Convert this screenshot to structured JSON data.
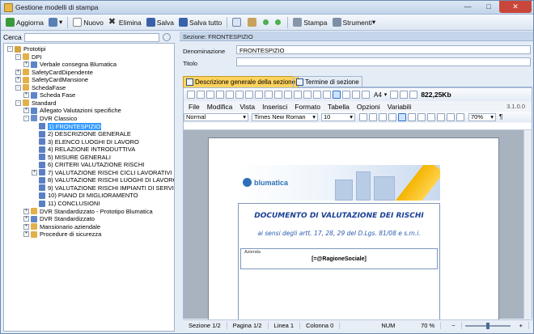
{
  "window": {
    "title": "Gestione modelli di stampa"
  },
  "toolbar": {
    "aggiorna": "Aggiorna",
    "nuovo": "Nuovo",
    "elimina": "Elimina",
    "salva": "Salva",
    "salva_tutto": "Salva tutto",
    "stampa": "Stampa",
    "strumenti": "Strumenti"
  },
  "search": {
    "label": "Cerca",
    "value": ""
  },
  "tree": [
    {
      "label": "Prototipi",
      "exp": "-"
    },
    {
      "label": "DPI",
      "exp": "-"
    },
    {
      "label": "Verbale consegna Blumatica",
      "exp": "+"
    },
    {
      "label": "SafetyCardDipendente",
      "exp": "+"
    },
    {
      "label": "SafetyCardMansione",
      "exp": "+"
    },
    {
      "label": "SchedaFase",
      "exp": "-"
    },
    {
      "label": "Scheda Fase",
      "exp": "+"
    },
    {
      "label": "Standard",
      "exp": "-"
    },
    {
      "label": "Allegato Valutazioni specifiche",
      "exp": "+"
    },
    {
      "label": "DVR Classico",
      "exp": "-"
    },
    {
      "label": "1) FRONTESPIZIO",
      "exp": ""
    },
    {
      "label": "2) DESCRIZIONE GENERALE",
      "exp": ""
    },
    {
      "label": "3) ELENCO LUOGHI DI LAVORO",
      "exp": ""
    },
    {
      "label": "4) RELAZIONE INTRODUTTIVA",
      "exp": ""
    },
    {
      "label": "5) MISURE GENERALI",
      "exp": ""
    },
    {
      "label": "6) CRITERI VALUTAZIONE RISCHI",
      "exp": ""
    },
    {
      "label": "7) VALUTAZIONE RISCHI CICLI LAVORATIVI",
      "exp": "+"
    },
    {
      "label": "8) VALUTAZIONE RISCHI LUOGHI DI LAVORO",
      "exp": ""
    },
    {
      "label": "9) VALUTAZIONE RISCHI IMPIANTI DI SERVIZIO",
      "exp": ""
    },
    {
      "label": "10) PIANO DI MIGLIORAMENTO",
      "exp": ""
    },
    {
      "label": "11) CONCLUSIONI",
      "exp": ""
    },
    {
      "label": "DVR Standardizzato - Prototipo Blumatica",
      "exp": "+"
    },
    {
      "label": "DVR Standardizzato",
      "exp": "+"
    },
    {
      "label": "Mansionario aziendale",
      "exp": "+"
    },
    {
      "label": "Procedure di sicurezza",
      "exp": "+"
    }
  ],
  "section": {
    "bar": "Sezione: FRONTESPIZIO",
    "denominazione_label": "Denominazione",
    "denominazione_value": "FRONTESPIZIO",
    "titolo_label": "Titolo",
    "titolo_value": ""
  },
  "tabs": {
    "tab1": "Descrizione generale della sezione",
    "tab2": "Termine di sezione"
  },
  "editor": {
    "menu": [
      "File",
      "Modifica",
      "Vista",
      "Inserisci",
      "Formato",
      "Tabella",
      "Opzioni",
      "Variabili"
    ],
    "version": "3.1.0.0",
    "size_label": "822,25Kb",
    "paper": "A4",
    "style": "Normal",
    "font": "Times New Roman",
    "font_size": "10",
    "zoom_combo": "70%"
  },
  "document": {
    "logo": "blumatica",
    "title": "DOCUMENTO DI VALUTAZIONE DEI RISCHI",
    "subtitle": "ai sensi degli artt. 17, 28, 29  del D.Lgs. 81/08 e s.m.i.",
    "azienda_label": "Azienda",
    "azienda_value": "[=@RagioneSociale]"
  },
  "status": {
    "sezione": "Sezione 1/2",
    "pagina": "Pagina 1/2",
    "linea": "Linea 1",
    "colonna": "Colonna 0",
    "num": "NUM",
    "zoom": "70 %"
  },
  "colors": {
    "accent": "#3399ff",
    "tab_active": "#ffd35c",
    "title_blue": "#1a3f94"
  }
}
